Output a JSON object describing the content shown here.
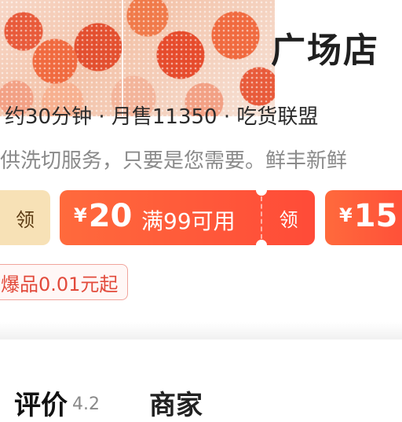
{
  "store": {
    "title": "广场店"
  },
  "meta": {
    "line": "约30分钟 · 月售11350 · 吃货联盟"
  },
  "description": {
    "line": "供洗切服务，只要是您需要。鲜丰新鲜"
  },
  "coupons": {
    "left_claim_label": "领",
    "main": {
      "currency": "¥",
      "amount": "20",
      "condition": "满99可用",
      "claim_label": "领"
    },
    "next": {
      "currency": "¥",
      "amount": "15"
    }
  },
  "promo": {
    "badge": "爆品0.01元起"
  },
  "tabs": {
    "reviews_label": "评价",
    "reviews_score": "4.2",
    "merchant_label": "商家"
  },
  "colors": {
    "coupon_red": "#ff4b38",
    "claim_gold_bg": "#f7e1b6",
    "promo_red": "#e24a3b"
  }
}
